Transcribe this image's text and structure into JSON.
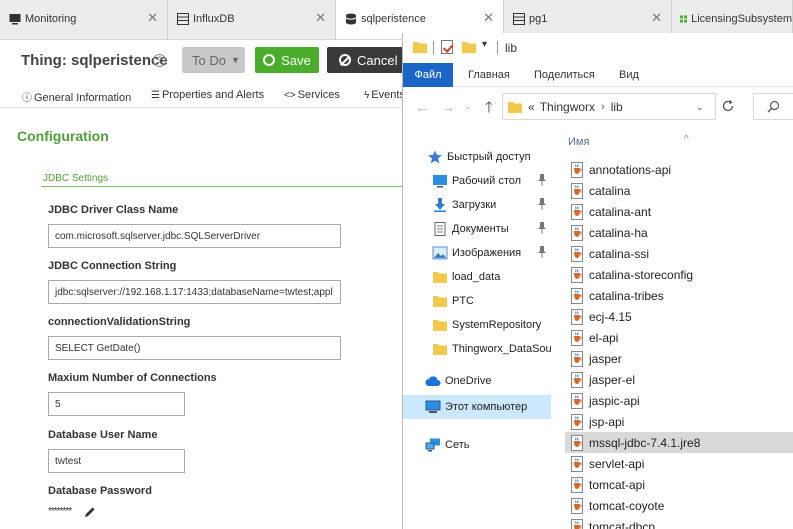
{
  "browser_tabs": [
    {
      "label": "Monitoring",
      "icon": "monitor-icon"
    },
    {
      "label": "InfluxDB",
      "icon": "table-icon"
    },
    {
      "label": "sqlperistence",
      "icon": "database-icon",
      "active": true
    },
    {
      "label": "pg1",
      "icon": "table-icon"
    },
    {
      "label": "LicensingSubsystem",
      "icon": "grid-icon"
    }
  ],
  "thing": {
    "title": "Thing: sqlperistence",
    "todo_label": "To Do",
    "save_label": "Save",
    "cancel_label": "Cancel"
  },
  "subtabs": [
    {
      "icon": "ⓘ",
      "label": "General Information"
    },
    {
      "icon": "☰",
      "label": "Properties and Alerts"
    },
    {
      "icon": "<>",
      "label": "Services"
    },
    {
      "icon": "ϟ",
      "label": "Events"
    }
  ],
  "config": {
    "title": "Configuration",
    "section": "JDBC Settings",
    "fields": [
      {
        "label": "JDBC Driver Class Name",
        "value": "com.microsoft.sqlserver.jdbc.SQLServerDriver"
      },
      {
        "label": "JDBC Connection String",
        "value": "jdbc:sqlserver://192.168.1.17:1433;databaseName=twtest;appl"
      },
      {
        "label": "connectionValidationString",
        "value": "SELECT GetDate()"
      },
      {
        "label": "Maxium Number of Connections",
        "value": "5"
      },
      {
        "label": "Database User Name",
        "value": "twtest"
      },
      {
        "label": "Database Password",
        "value": "********"
      }
    ]
  },
  "explorer": {
    "title": "lib",
    "ribbon": [
      "Файл",
      "Главная",
      "Поделиться",
      "Вид"
    ],
    "path": [
      "Thingworx",
      "lib"
    ],
    "path_prefix": "«",
    "column_name": "Имя",
    "nav": [
      {
        "label": "Быстрый доступ",
        "icon": "star-icon"
      },
      {
        "label": "Рабочий стол",
        "icon": "desktop-icon",
        "pinned": true
      },
      {
        "label": "Загрузки",
        "icon": "download-icon",
        "pinned": true
      },
      {
        "label": "Документы",
        "icon": "documents-icon",
        "pinned": true
      },
      {
        "label": "Изображения",
        "icon": "pictures-icon",
        "pinned": true
      },
      {
        "label": "load_data",
        "icon": "folder-icon"
      },
      {
        "label": "PTC",
        "icon": "folder-icon"
      },
      {
        "label": "SystemRepository",
        "icon": "folder-icon"
      },
      {
        "label": "Thingworx_DataSou",
        "icon": "folder-icon"
      },
      {
        "label": "OneDrive",
        "icon": "cloud-icon"
      },
      {
        "label": "Этот компьютер",
        "icon": "computer-icon",
        "selected": true
      },
      {
        "label": "Сеть",
        "icon": "network-icon"
      }
    ],
    "files": [
      "annotations-api",
      "catalina",
      "catalina-ant",
      "catalina-ha",
      "catalina-ssi",
      "catalina-storeconfig",
      "catalina-tribes",
      "ecj-4.15",
      "el-api",
      "jasper",
      "jasper-el",
      "jaspic-api",
      "jsp-api",
      "mssql-jdbc-7.4.1.jre8",
      "servlet-api",
      "tomcat-api",
      "tomcat-coyote",
      "tomcat-dbcp"
    ],
    "selected_file": "mssql-jdbc-7.4.1.jre8"
  },
  "colors": {
    "accent_green": "#4aae2c",
    "heading_green": "#4f9f3a",
    "file_tab_blue": "#1a66c7",
    "nav_selected": "#cce8ff",
    "file_selected": "#d9d9d9",
    "folder_yellow": "#f2c94c"
  }
}
